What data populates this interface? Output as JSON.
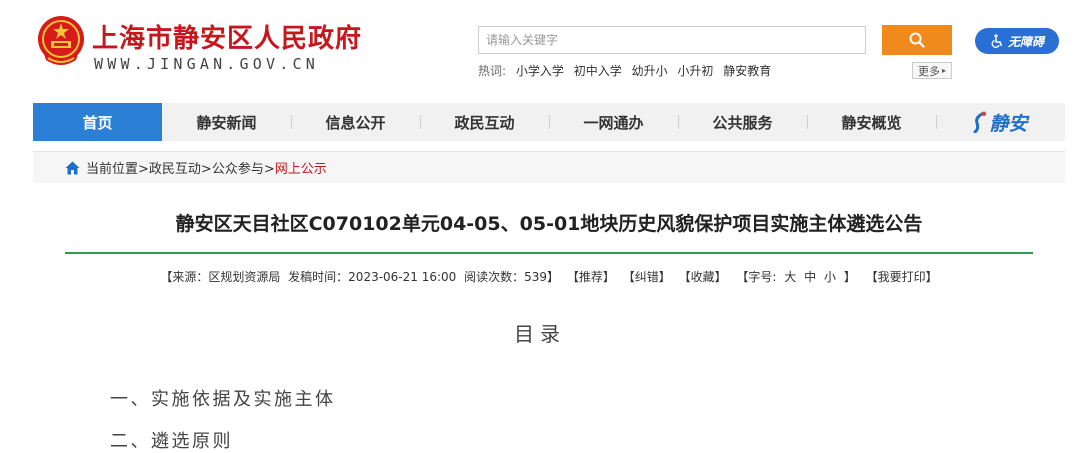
{
  "header": {
    "site_title": "上海市静安区人民政府",
    "site_domain": "WWW.JINGAN.GOV.CN",
    "search_placeholder": "请输入关键字",
    "accessibility_label": "无障碍",
    "hot_label": "热词:",
    "hot_words": [
      "小学入学",
      "初中入学",
      "幼升小",
      "小升初",
      "静安教育"
    ],
    "more_label": "更多"
  },
  "nav": {
    "items": [
      "首页",
      "静安新闻",
      "信息公开",
      "政民互动",
      "一网通办",
      "公共服务",
      "静安概览"
    ],
    "logo_text": "静安"
  },
  "breadcrumb": {
    "prefix": "当前位置>",
    "items": [
      "政民互动>",
      "公众参与>"
    ],
    "current": "网上公示"
  },
  "article": {
    "title": "静安区天目社区C070102单元04-05、05-01地块历史风貌保护项目实施主体遴选公告",
    "meta_source": "【来源：区规划资源局",
    "meta_time": "发稿时间：2023-06-21 16:00",
    "meta_reads": "阅读次数：539】",
    "meta_recommend": "【推荐】",
    "meta_correct": "【纠错】",
    "meta_favorite": "【收藏】",
    "meta_fontsize_label": "【字号:",
    "meta_fs_large": "大",
    "meta_fs_medium": "中",
    "meta_fs_small": "小",
    "meta_fontsize_end": "】",
    "meta_print": "【我要打印】"
  },
  "toc": {
    "heading": "目录",
    "items": [
      "一、实施依据及实施主体",
      "二、遴选原则"
    ]
  },
  "colors": {
    "brand_red": "#c8161d",
    "nav_blue": "#2b7fd4",
    "search_orange": "#f08a1c",
    "rule_green": "#2d9a54"
  }
}
